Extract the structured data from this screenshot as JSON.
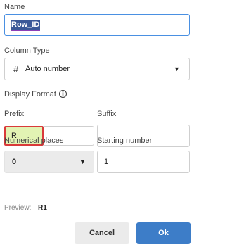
{
  "name": {
    "label": "Name",
    "value": "Row_ID"
  },
  "column_type": {
    "label": "Column Type",
    "icon": "hash-icon",
    "value": "Auto number"
  },
  "display_format": {
    "label": "Display Format",
    "info_icon": "info-icon"
  },
  "prefix": {
    "label": "Prefix",
    "value": "R"
  },
  "suffix": {
    "label": "Suffix",
    "value": ""
  },
  "numerical_places": {
    "label": "Numerical places",
    "value": "0"
  },
  "starting_number": {
    "label": "Starting number",
    "value": "1"
  },
  "preview": {
    "label": "Preview:",
    "value": "R1"
  },
  "buttons": {
    "cancel": "Cancel",
    "ok": "Ok"
  },
  "colors": {
    "primary": "#3d7dc8",
    "focus_border": "#4a90e2",
    "error_border": "#d93a3a",
    "prefix_fill": "#e2f3b3"
  }
}
